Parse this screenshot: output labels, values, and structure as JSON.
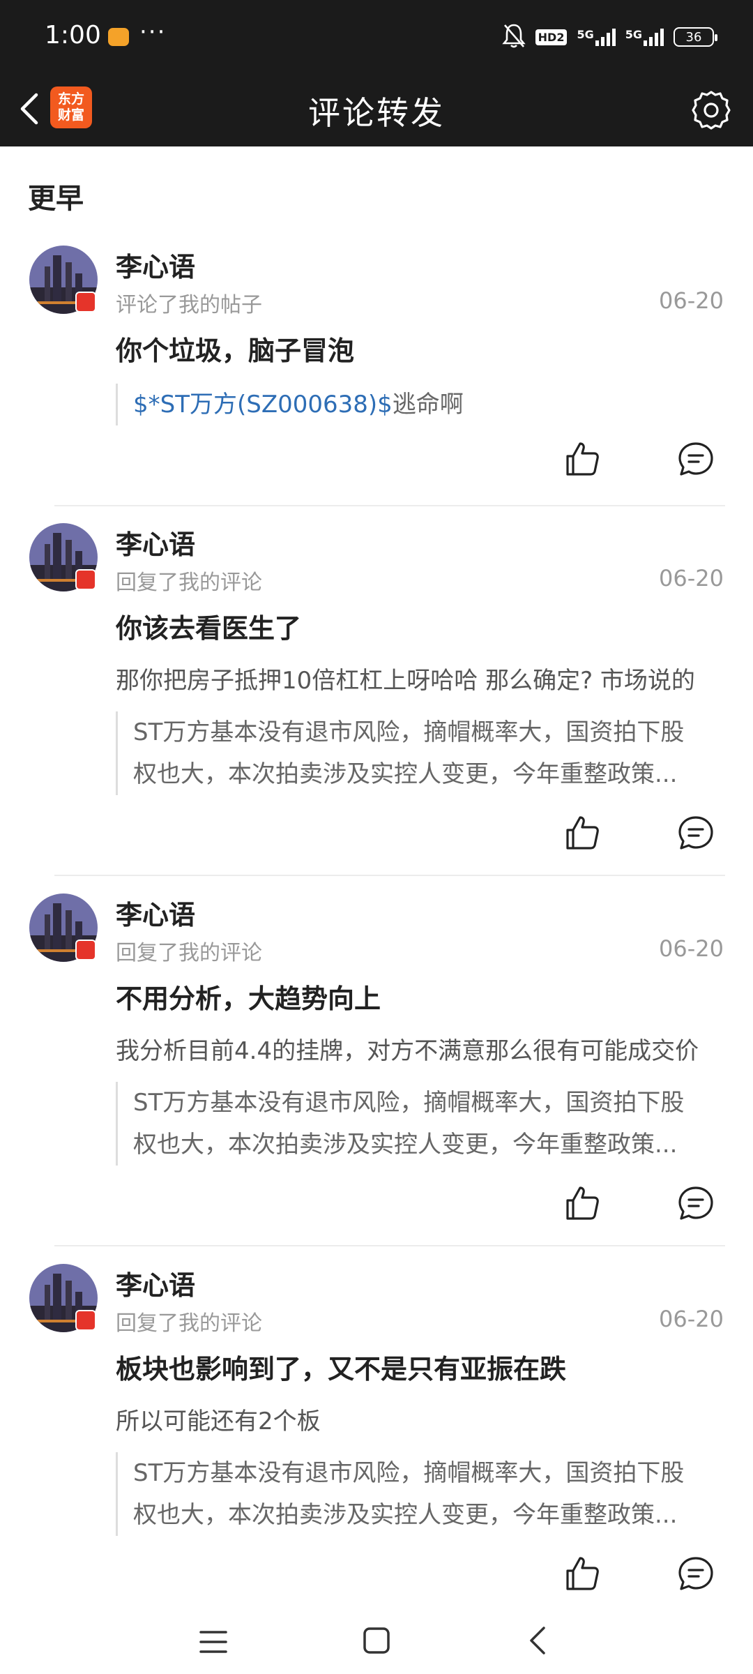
{
  "status_bar": {
    "time": "1:00",
    "more": "···",
    "hd_label": "HD2",
    "signal1_label": "5G",
    "signal2_label": "5G",
    "battery": "36"
  },
  "header": {
    "title": "评论转发",
    "logo_line1": "东方",
    "logo_line2": "财富"
  },
  "section_title": "更早",
  "items": [
    {
      "user": "李心语",
      "action": "评论了我的帖子",
      "date": "06-20",
      "comment": "你个垃圾，脑子冒泡",
      "quote_link": "$*ST万方(SZ000638)$",
      "quote_text": "逃命啊"
    },
    {
      "user": "李心语",
      "action": "回复了我的评论",
      "date": "06-20",
      "comment": "你该去看医生了",
      "reply_context": "那你把房子抵押10倍杠杠上呀哈哈 那么确定? 市场说的",
      "quote_line1": "ST万方基本没有退市风险，摘帽概率大，国资拍下股",
      "quote_line2": "权也大，本次拍卖涉及实控人变更，今年重整政策..."
    },
    {
      "user": "李心语",
      "action": "回复了我的评论",
      "date": "06-20",
      "comment": "不用分析，大趋势向上",
      "reply_context": "我分析目前4.4的挂牌，对方不满意那么很有可能成交价",
      "quote_line1": "ST万方基本没有退市风险，摘帽概率大，国资拍下股",
      "quote_line2": "权也大，本次拍卖涉及实控人变更，今年重整政策..."
    },
    {
      "user": "李心语",
      "action": "回复了我的评论",
      "date": "06-20",
      "comment": "板块也影响到了，又不是只有亚振在跌",
      "reply_context": "所以可能还有2个板",
      "quote_line1": "ST万方基本没有退市风险，摘帽概率大，国资拍下股",
      "quote_line2": "权也大，本次拍卖涉及实控人变更，今年重整政策..."
    }
  ],
  "icons": {
    "like": "thumbs-up-icon",
    "reply": "comment-bubble-icon",
    "settings": "gear-icon",
    "back": "chevron-left-icon"
  },
  "colors": {
    "header_bg": "#1b1b1b",
    "brand": "#f25a1f",
    "link": "#2d6db5",
    "muted": "#999999"
  }
}
